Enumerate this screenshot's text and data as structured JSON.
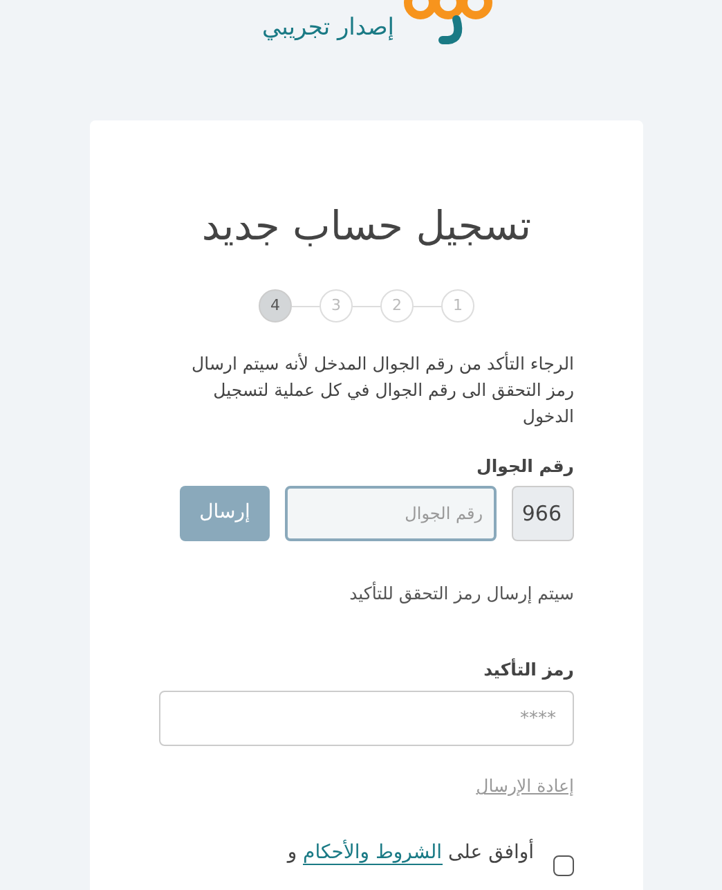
{
  "header": {
    "tagline": "إصدار تجريبي"
  },
  "card": {
    "title": "تسجيل حساب جديد",
    "steps": [
      {
        "label": "1",
        "selected": false
      },
      {
        "label": "2",
        "selected": false
      },
      {
        "label": "3",
        "selected": false
      },
      {
        "label": "4",
        "selected": true
      }
    ],
    "notice": "الرجاء التأكد من رقم الجوال المدخل لأنه سيتم ارسال رمز التحقق الى رقم الجوال في كل عملية لتسجيل الدخول",
    "phone": {
      "label": "رقم الجوال",
      "prefix": "966",
      "placeholder": "رقم الجوال",
      "button": "إرسال"
    },
    "send_note": "سيتم إرسال رمز التحقق للتأكيد",
    "code": {
      "label": "رمز التأكيد",
      "placeholder": "****"
    },
    "resend_link": "إعادة الإرسال",
    "terms": {
      "checked": false,
      "text_before": "أوافق على ",
      "link": "الشروط والأحكام",
      "text_after": " و"
    }
  }
}
